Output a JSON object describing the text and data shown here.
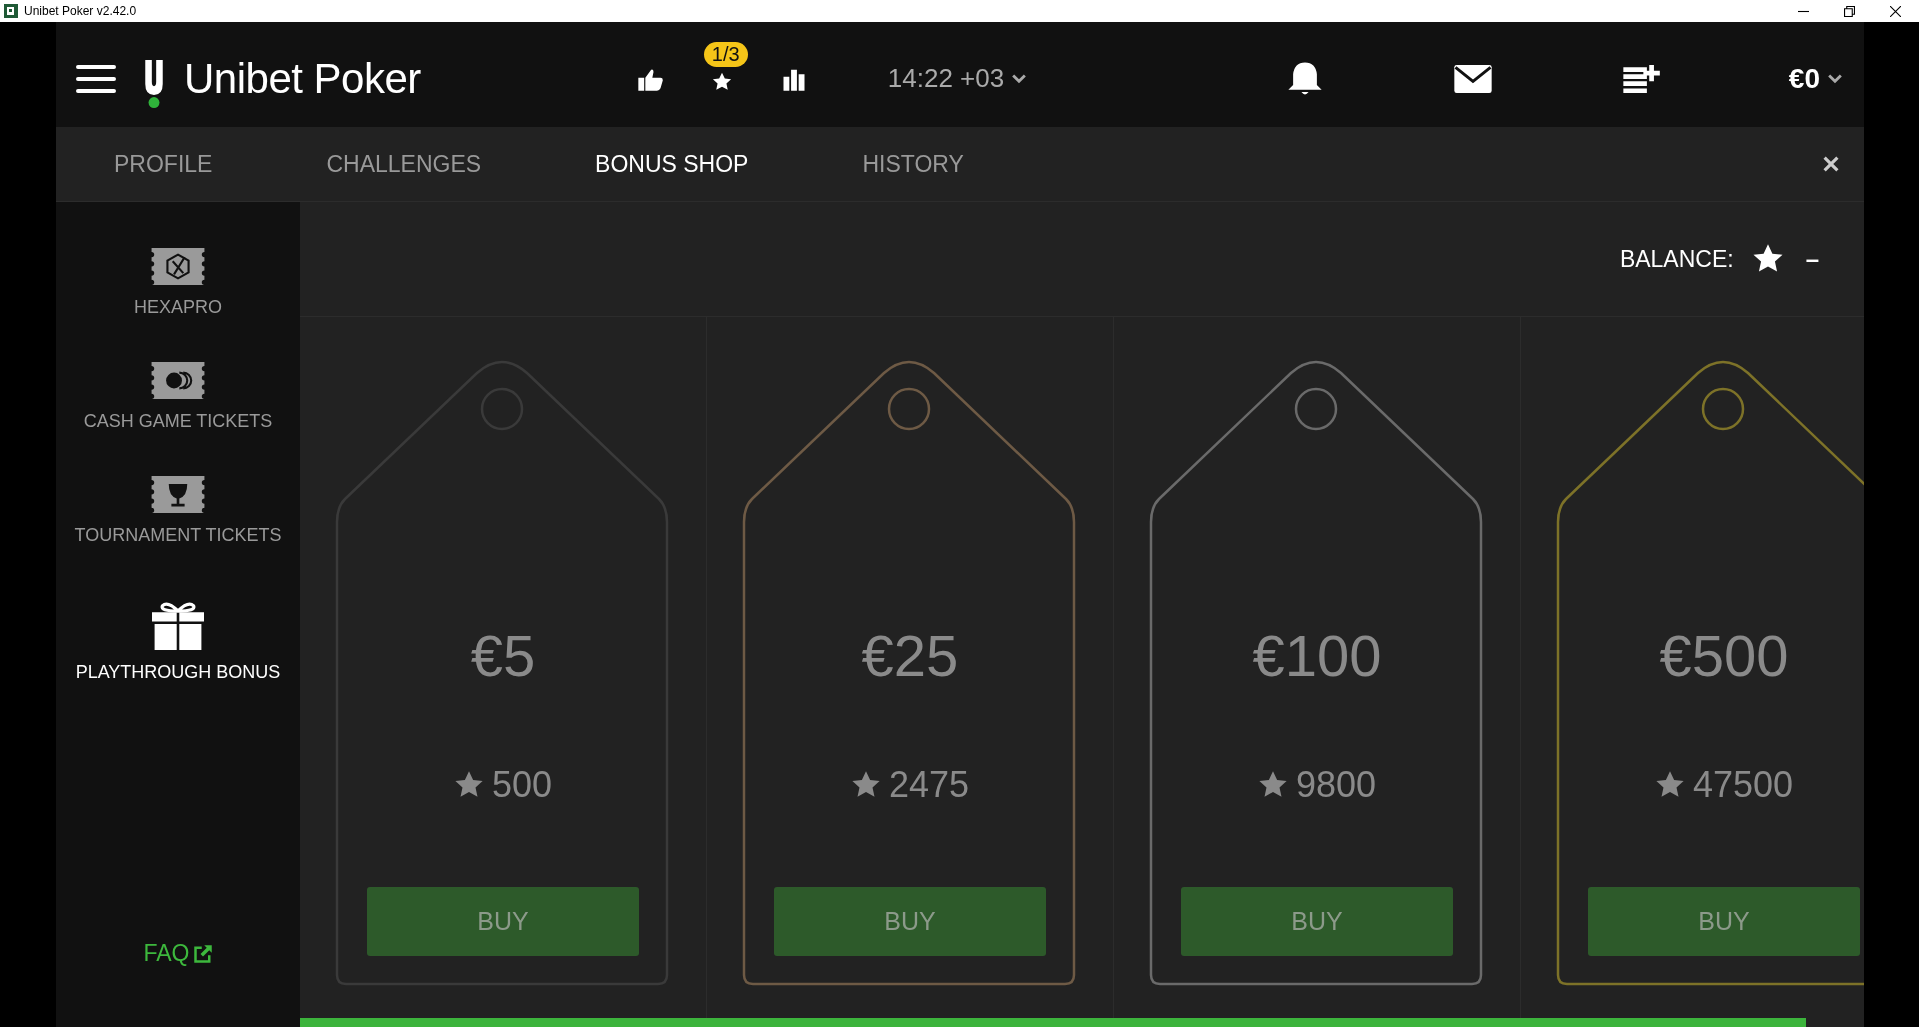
{
  "window": {
    "title": "Unibet Poker v2.42.0"
  },
  "header": {
    "brand": "Unibet Poker",
    "challenge_badge": "1/3",
    "time": "14:22 +03",
    "balance": "€0"
  },
  "tabs": [
    {
      "label": "PROFILE",
      "selected": false
    },
    {
      "label": "CHALLENGES",
      "selected": false
    },
    {
      "label": "BONUS SHOP",
      "selected": true
    },
    {
      "label": "HISTORY",
      "selected": false
    }
  ],
  "sidebar": {
    "items": [
      {
        "label": "HEXAPRO",
        "kind": "hexapro",
        "selected": false
      },
      {
        "label": "CASH GAME TICKETS",
        "kind": "cash",
        "selected": false
      },
      {
        "label": "TOURNAMENT TICKETS",
        "kind": "tournament",
        "selected": false
      },
      {
        "label": "PLAYTHROUGH BONUS",
        "kind": "gift",
        "selected": true
      }
    ],
    "faq": "FAQ"
  },
  "balance": {
    "label": "BALANCE:",
    "value": "–"
  },
  "offers": [
    {
      "price": "€5",
      "cost": "500",
      "button": "BUY",
      "color": "#3a3a3a"
    },
    {
      "price": "€25",
      "cost": "2475",
      "button": "BUY",
      "color": "#6e5a45"
    },
    {
      "price": "€100",
      "cost": "9800",
      "button": "BUY",
      "color": "#6a6a6a"
    },
    {
      "price": "€500",
      "cost": "47500",
      "button": "BUY",
      "color": "#7d7228"
    }
  ]
}
